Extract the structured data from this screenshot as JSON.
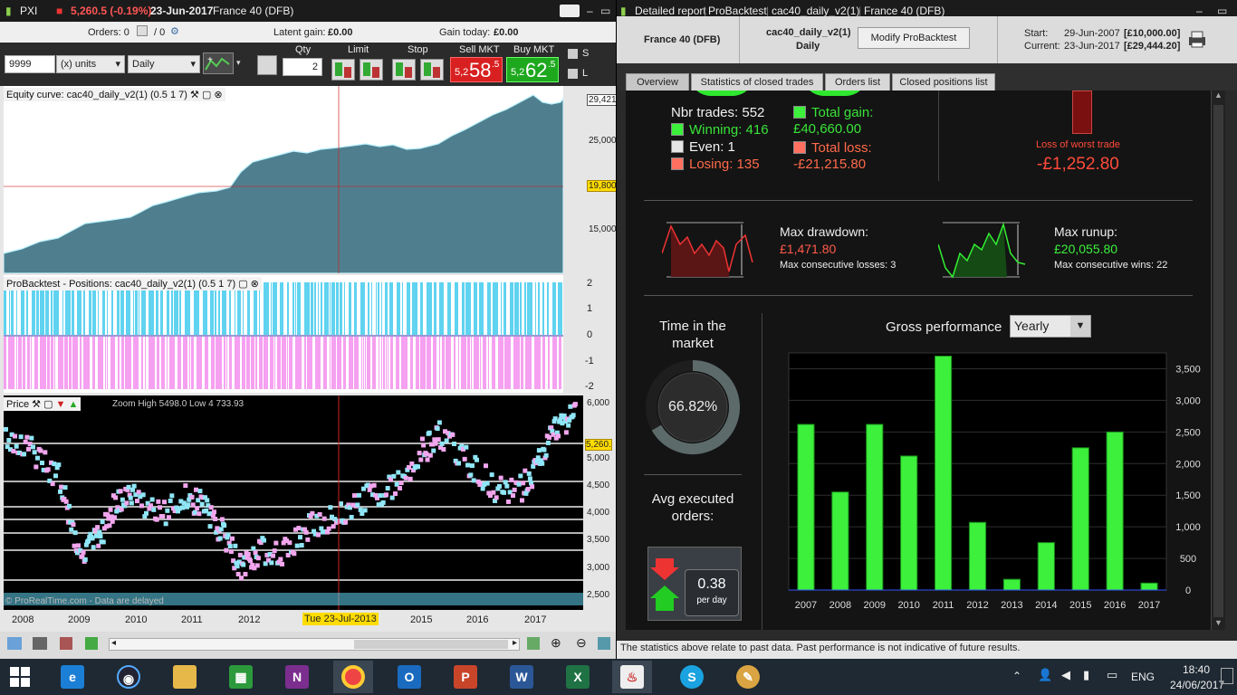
{
  "left": {
    "title": {
      "symbol": "PXI",
      "price": "5,260.5 (-0.19%)",
      "date": "23-Jun-2017",
      "market": "France 40 (DFB)"
    },
    "status": {
      "orders_label": "Orders: 0",
      "orders_sep": "/ 0",
      "latent_label": "Latent gain:",
      "latent_value": "£0.00",
      "gain_today_label": "Gain today:",
      "gain_today_value": "£0.00"
    },
    "toolbar": {
      "qty_header": "Qty",
      "limit_header": "Limit",
      "stop_header": "Stop",
      "sell_header": "Sell MKT",
      "buy_header": "Buy MKT",
      "units_value": "9999",
      "units_type": "(x) units",
      "period": "Daily",
      "qty_value": "2",
      "sell_small": "5,2",
      "sell_big": "58",
      "sell_sup": ".5",
      "buy_small": "5,2",
      "buy_big": "62",
      "buy_sup": ".5",
      "s_label": "S",
      "l_label": "L"
    },
    "equity": {
      "title": "Equity curve: cac40_daily_v2(1) (0.5 1 7)",
      "current": "29,421",
      "marker": "19,800",
      "ticks": [
        "25,000",
        "15,000"
      ]
    },
    "positions": {
      "title": "ProBacktest - Positions: cac40_daily_v2(1) (0.5 1 7)",
      "ticks": [
        "2",
        "1",
        "0",
        "-1",
        "-2"
      ]
    },
    "price": {
      "title": "Price",
      "zoom_info": "Zoom High 5498.0 Low 4 733.93",
      "last": "5,260.",
      "ticks": [
        "6,000",
        "5,000",
        "4,500",
        "4,000",
        "3,500",
        "3,000",
        "2,500"
      ],
      "footer": "© ProRealTime.com - Data are delayed"
    },
    "xaxis": [
      "2008",
      "2009",
      "2010",
      "2011",
      "2012",
      "2015",
      "2016",
      "2017"
    ],
    "cursor_date": "Tue 23-Jul-2013"
  },
  "right": {
    "title": {
      "a": "Detailed report",
      "b": "ProBacktest",
      "c": "cac40_daily_v2(1)",
      "d": "France 40 (DFB)"
    },
    "header": {
      "market": "France 40 (DFB)",
      "system": "cac40_daily_v2(1)",
      "period": "Daily",
      "modify": "Modify ProBacktest",
      "start_label": "Start:",
      "start_date": "29-Jun-2007",
      "start_value": "[£10,000.00]",
      "current_label": "Current:",
      "current_date": "23-Jun-2017",
      "current_value": "[£29,444.20]"
    },
    "tabs": [
      "Overview",
      "Statistics of closed trades",
      "Orders list",
      "Closed positions list"
    ],
    "trades": {
      "nbr": "Nbr trades: 552",
      "winning": "Winning: 416",
      "even": "Even: 1",
      "losing": "Losing: 135",
      "total_gain_label": "Total gain:",
      "total_gain": "£40,660.00",
      "total_loss_label": "Total loss:",
      "total_loss": "-£21,215.80",
      "worst_label": "Loss of worst trade",
      "worst_value": "-£1,252.80"
    },
    "drawdown": {
      "label": "Max drawdown:",
      "value": "£1,471.80",
      "sub": "Max consecutive losses: 3"
    },
    "runup": {
      "label": "Max runup:",
      "value": "£20,055.80",
      "sub": "Max consecutive wins: 22"
    },
    "time_in_market": {
      "label": "Time in the market",
      "value": "66.82%",
      "fraction": 0.6682
    },
    "avg_orders": {
      "label": "Avg executed orders:",
      "value": "0.38",
      "unit": "per day"
    },
    "footer": "The statistics above relate to past data. Past performance is not indicative of future results."
  },
  "chart_data": {
    "type": "bar",
    "title": "Gross performance",
    "period_select": "Yearly",
    "categories": [
      "2007",
      "2008",
      "2009",
      "2010",
      "2011",
      "2012",
      "2013",
      "2014",
      "2015",
      "2016",
      "2017"
    ],
    "values": [
      2620,
      1550,
      2620,
      2120,
      3700,
      1070,
      170,
      750,
      2250,
      2500,
      110
    ],
    "yticks": [
      0,
      500,
      1000,
      1500,
      2000,
      2500,
      3000,
      3500
    ],
    "ylim": [
      0,
      3750
    ],
    "bar_color": "#3cf03c"
  },
  "taskbar": {
    "lang": "ENG",
    "time": "18:40",
    "date": "24/06/2017"
  }
}
